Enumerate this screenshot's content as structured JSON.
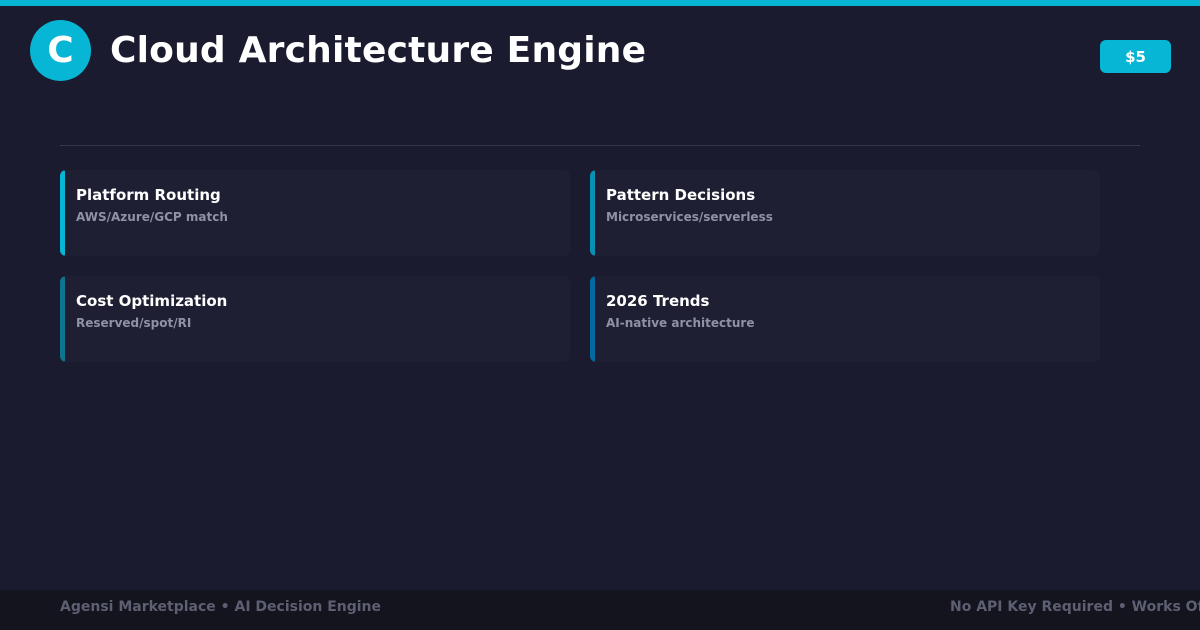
{
  "header": {
    "logo_letter": "C",
    "title": "Cloud Architecture Engine",
    "price": "$5"
  },
  "cards": [
    {
      "title": "Platform Routing",
      "subtitle": "AWS/Azure/GCP match",
      "accent": "#06b6d4"
    },
    {
      "title": "Pattern Decisions",
      "subtitle": "Microservices/serverless",
      "accent": "#0891b2"
    },
    {
      "title": "Cost Optimization",
      "subtitle": "Reserved/spot/RI",
      "accent": "#0e7490"
    },
    {
      "title": "2026 Trends",
      "subtitle": "AI-native architecture",
      "accent": "#0369a1"
    }
  ],
  "footer": {
    "left": "Agensi Marketplace • AI Decision Engine",
    "right": "No API Key Required • Works Offline"
  },
  "colors": {
    "background": "#1b1b2f",
    "accent": "#06b6d4",
    "card": "#1f1f33",
    "footer": "#14141f"
  }
}
